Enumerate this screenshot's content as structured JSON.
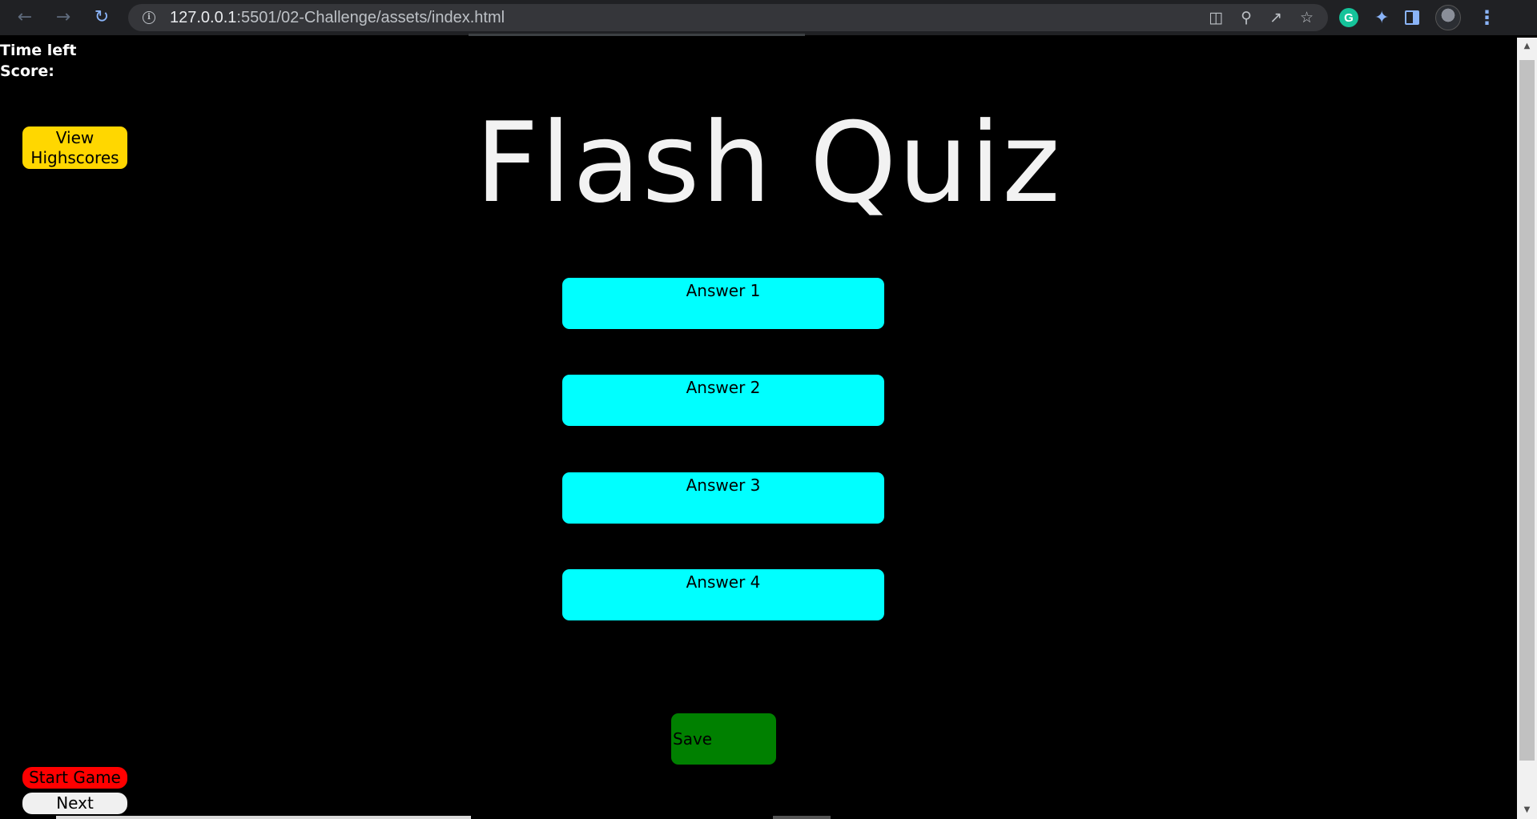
{
  "browser": {
    "url_host": "127.0.0.1",
    "url_rest": ":5501/02-Challenge/assets/index.html",
    "nav_icons": [
      "back-arrow-icon",
      "forward-arrow-icon",
      "reload-icon"
    ],
    "omnibox_icons": [
      "translate-icon",
      "zoom-icon",
      "share-icon",
      "star-icon"
    ],
    "extension_icons": [
      "grammarly-icon",
      "extensions-puzzle-icon",
      "side-panel-icon",
      "profile-avatar",
      "menu-kebab-icon"
    ],
    "grammarly_letter": "G",
    "colors": {
      "frame": "#202124",
      "omnibox": "#35363a",
      "accent": "#8ab4f8"
    }
  },
  "quiz": {
    "time_left_label": "Time left",
    "score_label": "Score:",
    "highscores_button": "View Highscores",
    "title": "Flash Quiz",
    "answers": [
      "Answer 1",
      "Answer 2",
      "Answer 3",
      "Answer 4"
    ],
    "save_button": "Save",
    "start_button": "Start Game",
    "next_button": "Next",
    "colors": {
      "background": "#000000",
      "highscores": "#ffd700",
      "answer": "#00ffff",
      "save": "#008000",
      "start": "#ff0000",
      "next": "#f0f0f0",
      "title": "#f2f2f2"
    }
  }
}
